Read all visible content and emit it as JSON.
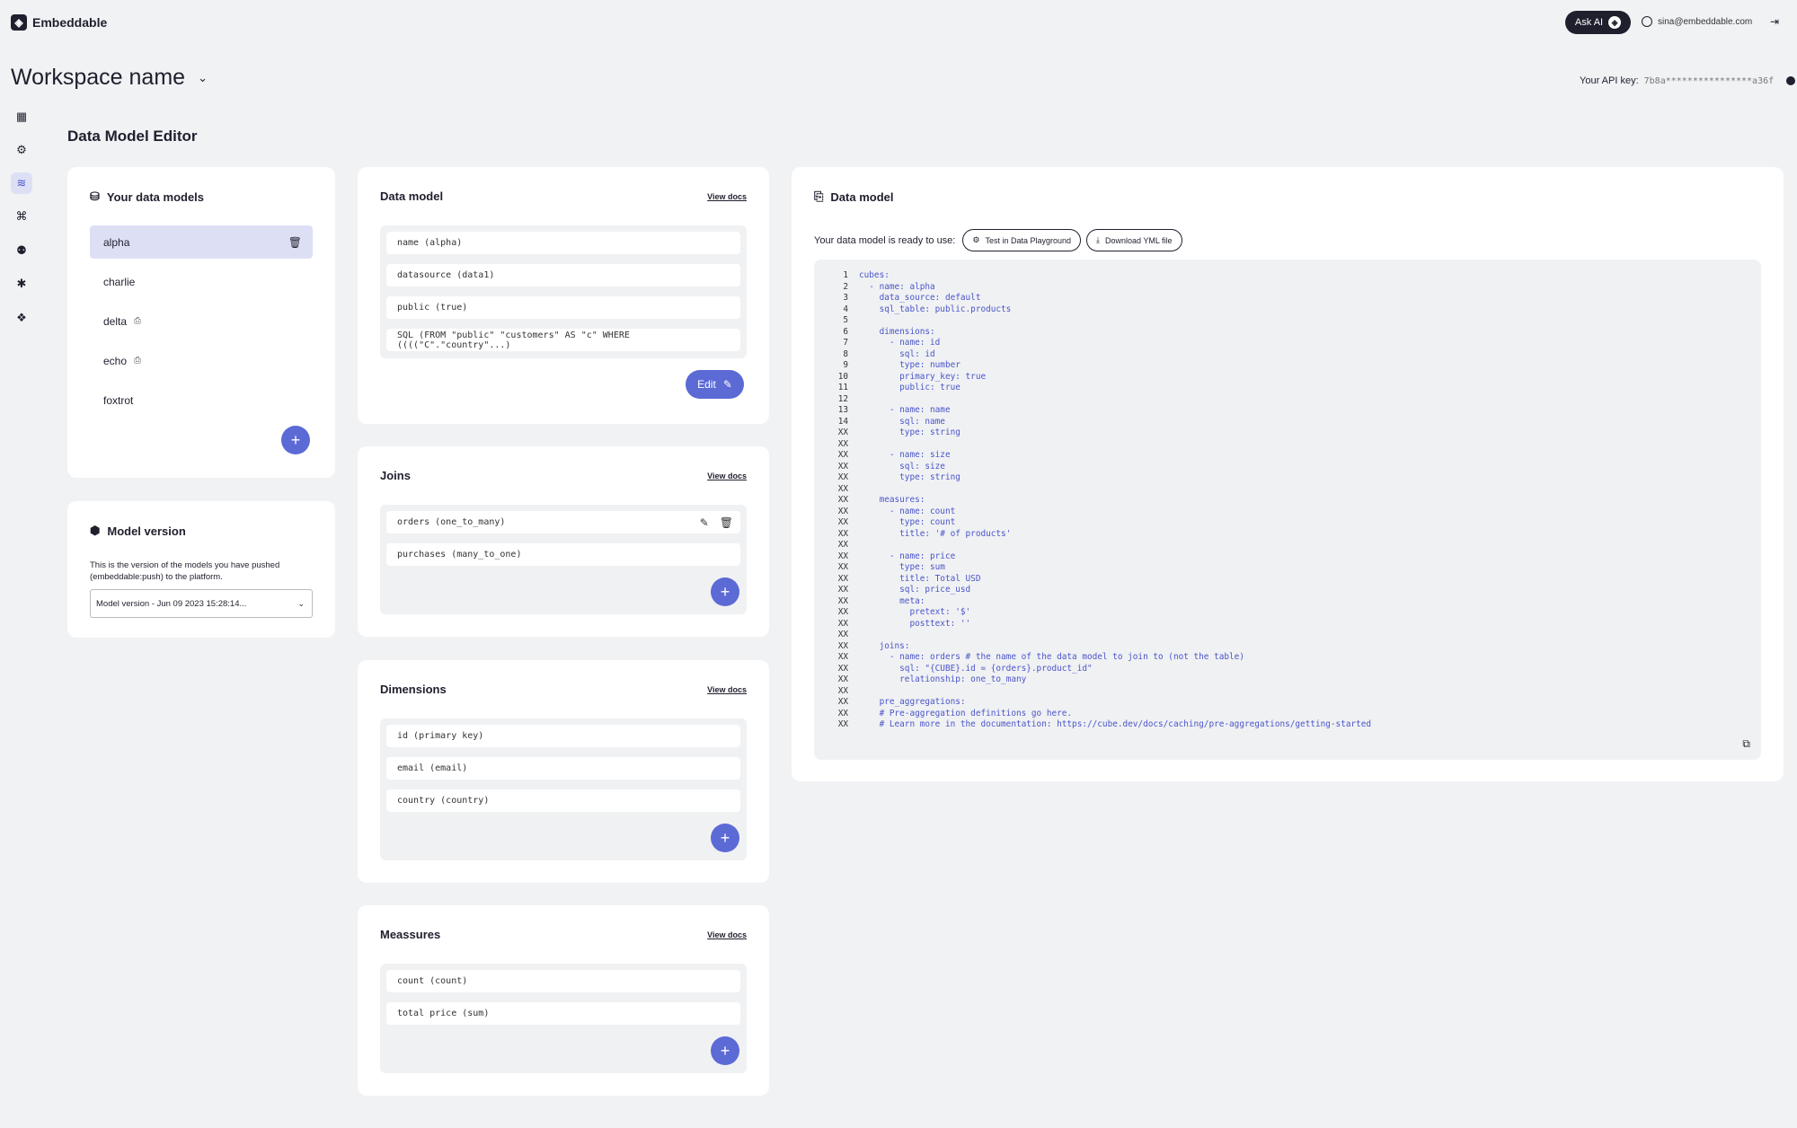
{
  "app": {
    "name": "Embeddable",
    "ask_ai": "Ask AI",
    "user_email": "sina@embeddable.com"
  },
  "workspace": {
    "name": "Workspace name",
    "api_key_label": "Your API key:",
    "api_key_value": "7b8a****************a36f"
  },
  "page_title": "Data Model Editor",
  "sidebar_icons": [
    "dashboard-icon",
    "playground-icon",
    "data-model-icon",
    "connections-icon",
    "team-icon",
    "settings-icon",
    "chat-icon"
  ],
  "your_models": {
    "title": "Your data models",
    "items": [
      {
        "label": "alpha",
        "selected": true
      },
      {
        "label": "charlie",
        "selected": false
      },
      {
        "label": "delta",
        "selected": false,
        "icon": "version-icon"
      },
      {
        "label": "echo",
        "selected": false,
        "icon": "version-icon"
      },
      {
        "label": "foxtrot",
        "selected": false
      }
    ]
  },
  "model_version": {
    "title": "Model version",
    "description": "This is the version of the models you have pushed (embeddable:push) to the platform.",
    "selected": "Model version - Jun 09 2023 15:28:14..."
  },
  "data_model_card": {
    "title": "Data model",
    "view_docs": "View docs",
    "rows": [
      "name (alpha)",
      "datasource (data1)",
      "public (true)",
      "SQL (FROM \"public\" \"customers\" AS \"c\" WHERE ((((\"C\".\"country\"...)"
    ],
    "edit_label": "Edit"
  },
  "joins": {
    "title": "Joins",
    "view_docs": "View docs",
    "rows": [
      "orders (one_to_many)",
      "purchases (many_to_one)"
    ]
  },
  "dimensions": {
    "title": "Dimensions",
    "view_docs": "View docs",
    "rows": [
      "id (primary key)",
      "email (email)",
      "country (country)"
    ]
  },
  "measures": {
    "title": "Meassures",
    "view_docs": "View docs",
    "rows": [
      "count (count)",
      "total price (sum)"
    ]
  },
  "yaml_card": {
    "title": "Data model",
    "ready_text": "Your data model is ready to use:",
    "test_button": "Test in Data Playground",
    "download_button": "Download YML file",
    "lines": [
      [
        "1",
        "cubes:"
      ],
      [
        "2",
        "  - name: alpha"
      ],
      [
        "3",
        "    data_source: default"
      ],
      [
        "4",
        "    sql_table: public.products"
      ],
      [
        "5",
        ""
      ],
      [
        "6",
        "    dimensions:"
      ],
      [
        "7",
        "      - name: id"
      ],
      [
        "8",
        "        sql: id"
      ],
      [
        "9",
        "        type: number"
      ],
      [
        "10",
        "        primary_key: true"
      ],
      [
        "11",
        "        public: true"
      ],
      [
        "12",
        ""
      ],
      [
        "13",
        "      - name: name"
      ],
      [
        "14",
        "        sql: name"
      ],
      [
        "XX",
        "        type: string"
      ],
      [
        "XX",
        ""
      ],
      [
        "XX",
        "      - name: size"
      ],
      [
        "XX",
        "        sql: size"
      ],
      [
        "XX",
        "        type: string"
      ],
      [
        "XX",
        ""
      ],
      [
        "XX",
        "    measures:"
      ],
      [
        "XX",
        "      - name: count"
      ],
      [
        "XX",
        "        type: count"
      ],
      [
        "XX",
        "        title: '# of products'"
      ],
      [
        "XX",
        ""
      ],
      [
        "XX",
        "      - name: price"
      ],
      [
        "XX",
        "        type: sum"
      ],
      [
        "XX",
        "        title: Total USD"
      ],
      [
        "XX",
        "        sql: price_usd"
      ],
      [
        "XX",
        "        meta:"
      ],
      [
        "XX",
        "          pretext: '$'"
      ],
      [
        "XX",
        "          posttext: ''"
      ],
      [
        "XX",
        ""
      ],
      [
        "XX",
        "    joins:"
      ],
      [
        "XX",
        "      - name: orders # the name of the data model to join to (not the table)"
      ],
      [
        "XX",
        "        sql: \"{CUBE}.id = {orders}.product_id\""
      ],
      [
        "XX",
        "        relationship: one_to_many"
      ],
      [
        "XX",
        ""
      ],
      [
        "XX",
        "    pre_aggregations:"
      ],
      [
        "XX",
        "    # Pre-aggregation definitions go here."
      ],
      [
        "XX",
        "    # Learn more in the documentation: https://cube.dev/docs/caching/pre-aggregations/getting-started"
      ]
    ]
  }
}
